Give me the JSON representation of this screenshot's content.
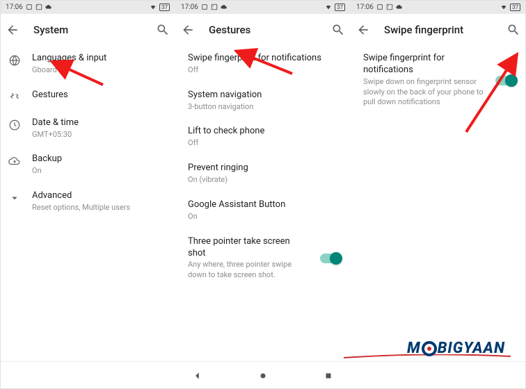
{
  "status": {
    "time": "17:06",
    "battery_label": "37"
  },
  "col1": {
    "title": "System",
    "items": [
      {
        "title": "Languages & input",
        "sub": "Gboard",
        "icon": "globe"
      },
      {
        "title": "Gestures",
        "icon": "gestures"
      },
      {
        "title": "Date & time",
        "sub": "GMT+05:30",
        "icon": "clock"
      },
      {
        "title": "Backup",
        "sub": "On",
        "icon": "cloud-up"
      },
      {
        "title": "Advanced",
        "sub": "Reset options, Multiple users",
        "icon": "expand"
      }
    ]
  },
  "col2": {
    "title": "Gestures",
    "items": [
      {
        "title": "Swipe fingerprint for notifications",
        "sub": "Off"
      },
      {
        "title": "System navigation",
        "sub": "3-button navigation"
      },
      {
        "title": "Lift to check phone",
        "sub": "Off"
      },
      {
        "title": "Prevent ringing",
        "sub": "On (vibrate)"
      },
      {
        "title": "Google Assistant Button",
        "sub": "On"
      },
      {
        "title": "Three pointer take screen shot",
        "sub": "Any where, three pointer swipe down to take screen shot.",
        "toggle": "on"
      }
    ]
  },
  "col3": {
    "title": "Swipe fingerprint",
    "item": {
      "title": "Swipe fingerprint for notifications",
      "sub": "Swipe down on fingerprint sensor slowly on the back of your phone to pull down notifications",
      "toggle": "on"
    }
  },
  "watermark": {
    "pre": "M",
    "mid": "BIGYAAN"
  }
}
